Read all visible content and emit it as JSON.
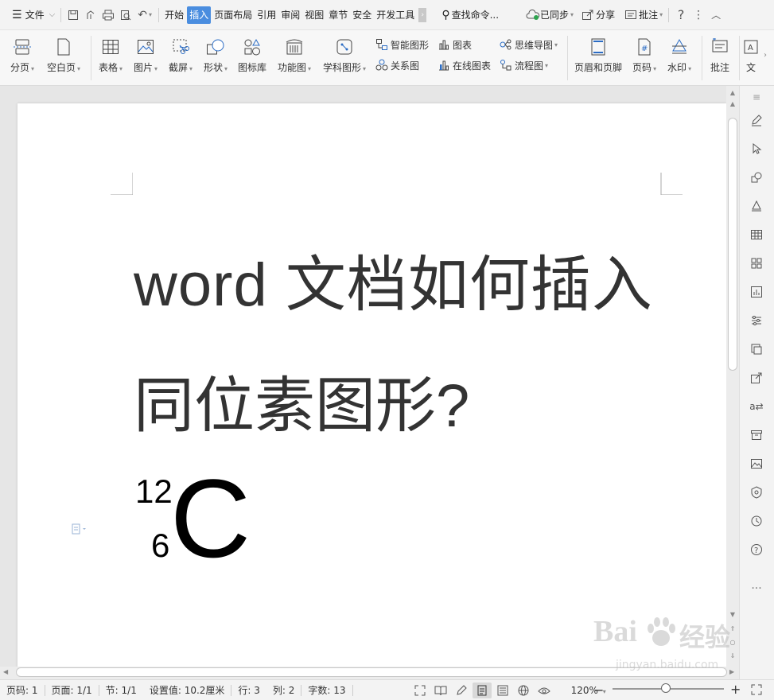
{
  "menubar": {
    "file_label": "文件",
    "tabs": [
      "开始",
      "插入",
      "页面布局",
      "引用",
      "审阅",
      "视图",
      "章节",
      "安全",
      "开发工具"
    ],
    "active_tab": "插入",
    "search_label": "查找命令...",
    "sync_label": "已同步",
    "share_label": "分享",
    "comment_label": "批注"
  },
  "ribbon": {
    "page_break": "分页",
    "blank_page": "空白页",
    "table": "表格",
    "picture": "图片",
    "screenshot": "截屏",
    "shape": "形状",
    "icon_lib": "图标库",
    "func_chart": "功能图",
    "subject_chart": "学科图形",
    "smart_art": "智能图形",
    "chart": "图表",
    "relation": "关系图",
    "online_chart": "在线图表",
    "mind_map": "思维导图",
    "flow_chart": "流程图",
    "header_footer": "页眉和页脚",
    "page_number": "页码",
    "watermark": "水印",
    "comment": "批注",
    "text": "文"
  },
  "document": {
    "title_line1": "word 文档如何插入",
    "title_line2": "同位素图形?",
    "isotope": {
      "mass_number": "12",
      "atomic_number": "6",
      "symbol": "C"
    }
  },
  "statusbar": {
    "page_num": "页码: 1",
    "pages": "页面: 1/1",
    "section": "节: 1/1",
    "setting": "设置值: 10.2厘米",
    "row": "行: 3",
    "col": "列: 2",
    "words": "字数: 13",
    "zoom": "120%",
    "zoom_level": 0.48
  },
  "watermark": {
    "brand": "Bai",
    "brand2": "经验",
    "url": "jingyan.baidu.com"
  },
  "colors": {
    "accent": "#4a8ddf",
    "icon_blue": "#2b6cc4"
  }
}
